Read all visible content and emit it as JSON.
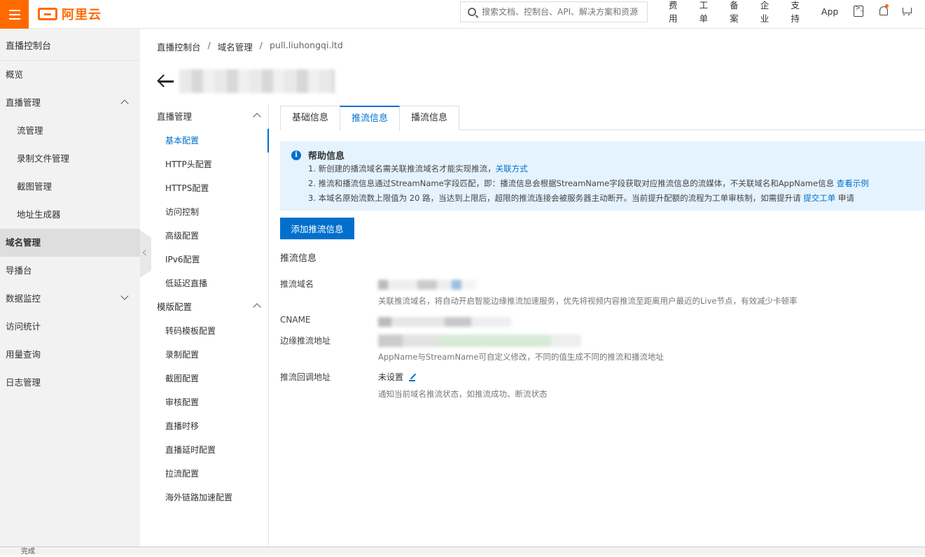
{
  "topbar": {
    "logo_text": "阿里云",
    "search_placeholder": "搜索文档、控制台、API、解决方案和资源",
    "nav": [
      "费用",
      "工单",
      "备案",
      "企业",
      "支持",
      "App"
    ]
  },
  "sidebar": {
    "title": "直播控制台",
    "items": [
      {
        "label": "概览"
      },
      {
        "label": "直播管理"
      },
      {
        "label": "流管理"
      },
      {
        "label": "录制文件管理"
      },
      {
        "label": "截图管理"
      },
      {
        "label": "地址生成器"
      },
      {
        "label": "域名管理"
      },
      {
        "label": "导播台"
      },
      {
        "label": "数据监控"
      },
      {
        "label": "访问统计"
      },
      {
        "label": "用量查询"
      },
      {
        "label": "日志管理"
      }
    ]
  },
  "breadcrumb": {
    "items": [
      "直播控制台",
      "域名管理",
      "pull.liuhongqi.ltd"
    ],
    "separator": "/"
  },
  "subnav": {
    "group1": "直播管理",
    "group1_items": [
      "基本配置",
      "HTTP头配置",
      "HTTPS配置",
      "访问控制",
      "高级配置",
      "IPv6配置",
      "低延迟直播"
    ],
    "group2": "模版配置",
    "group2_items": [
      "转码模板配置",
      "录制配置",
      "截图配置",
      "审核配置",
      "直播时移",
      "直播延时配置",
      "拉流配置",
      "海外链路加速配置"
    ]
  },
  "tabs": [
    "基础信息",
    "推流信息",
    "播流信息"
  ],
  "help": {
    "title": "帮助信息",
    "line1": "1. 新创建的播流域名需关联推流域名才能实现推流，",
    "line1_link": "关联方式",
    "line2": "2. 推流和播流信息通过StreamName字段匹配，即：播流信息会根据StreamName字段获取对应推流信息的流媒体，不关联域名和AppName信息",
    "line2_link": "查看示例",
    "line3": "3. 本域名原始流数上限值为 20 路，当达到上限后，超限的推流连接会被服务器主动断开。当前提升配额的流程为工单审核制，如需提升请",
    "line3_link": "提交工单",
    "line3_tail": "申请"
  },
  "add_button": "添加推流信息",
  "section_title": "推流信息",
  "fields": {
    "push_domain_label": "推流域名",
    "push_domain_desc": "关联推流域名，将自动开启智能边缘推流加速服务，优先将视频内容推流至距离用户最近的Live节点，有效减少卡顿率",
    "cname_label": "CNAME",
    "edge_label": "边缘推流地址",
    "edge_desc": "AppName与StreamName可自定义修改，不同的值生成不同的推流和播流地址",
    "callback_label": "推流回调地址",
    "callback_value": "未设置",
    "callback_desc": "通知当前域名推流状态，如推流成功、断流状态"
  },
  "statusbar": {
    "text": "完成"
  }
}
